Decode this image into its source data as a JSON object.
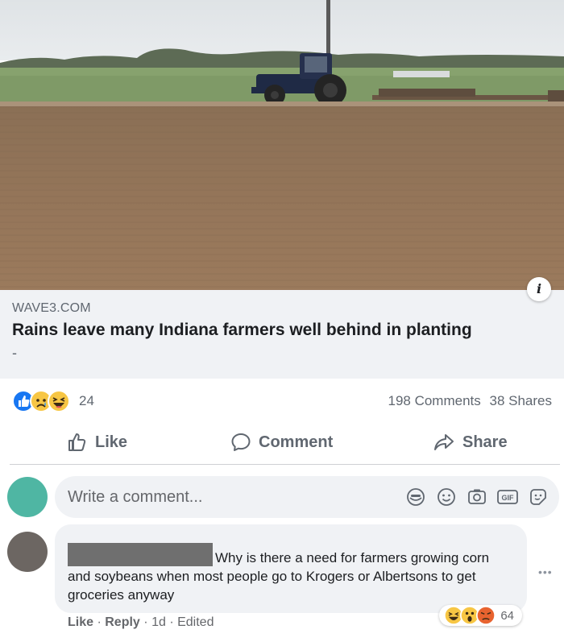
{
  "link_preview": {
    "domain": "WAVE3.COM",
    "title": "Rains leave many Indiana farmers well behind in planting",
    "description": "-",
    "info_glyph": "i"
  },
  "summary": {
    "reaction_count": "24",
    "comments": "198 Comments",
    "shares": "38 Shares"
  },
  "actions": {
    "like": "Like",
    "comment": "Comment",
    "share": "Share"
  },
  "composer": {
    "placeholder": "Write a comment...",
    "icons": [
      "sticker-icon",
      "emoji-icon",
      "camera-icon",
      "gif-icon",
      "sticker-face-icon"
    ]
  },
  "comment": {
    "text": "Why is there a need for farmers growing corn and soybeans when most people go to Krogers or Albertsons to get groceries anyway",
    "reaction_count": "64",
    "like": "Like",
    "reply": "Reply",
    "age": "1d",
    "edited": "Edited",
    "separator": "·"
  },
  "colors": {
    "facebook_blue": "#1877f2",
    "muted_text": "#606770",
    "bubble": "#f0f2f5"
  }
}
